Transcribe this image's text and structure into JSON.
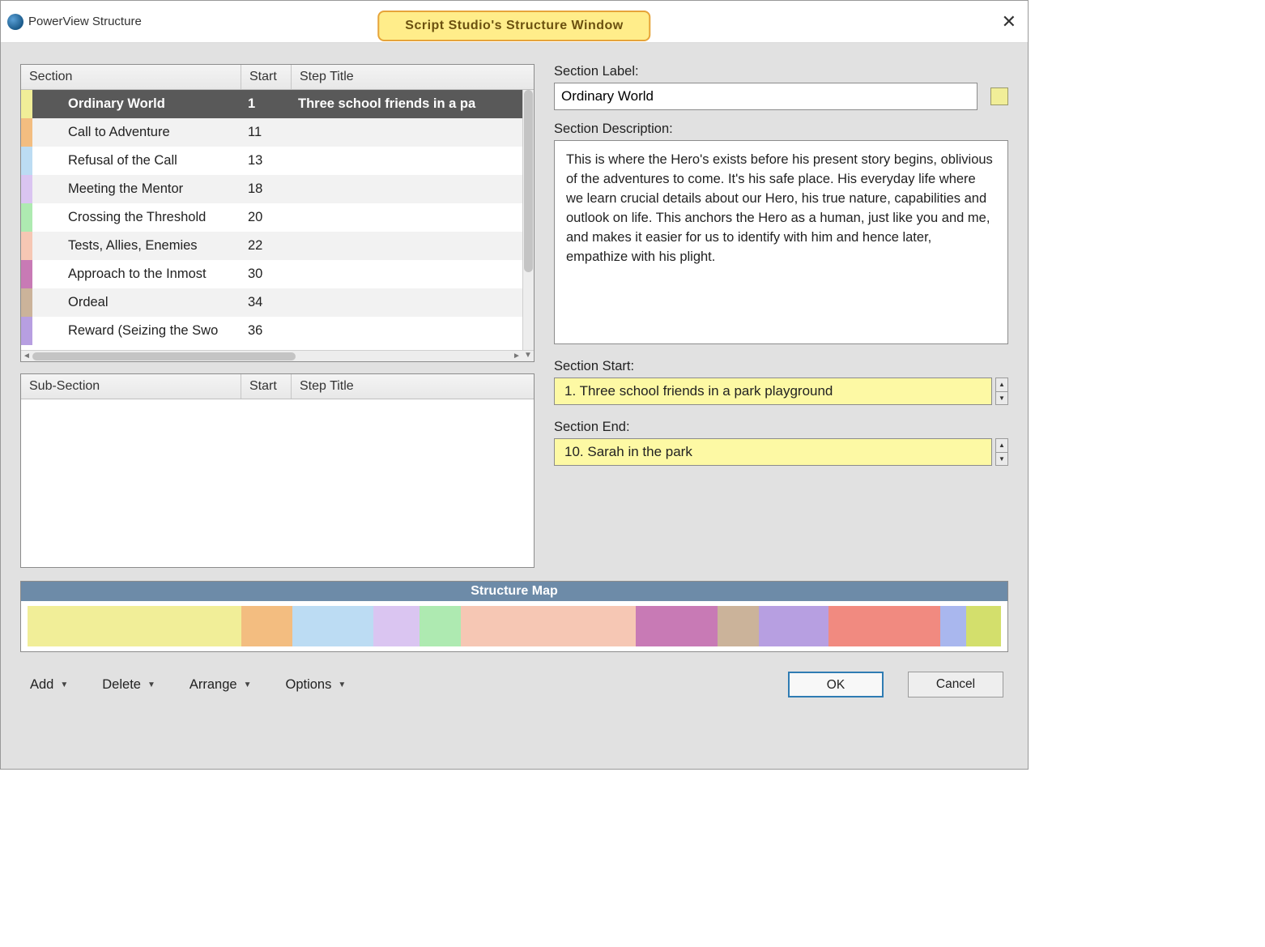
{
  "window": {
    "title": "PowerView Structure",
    "banner": "Script Studio's Structure Window"
  },
  "section_table": {
    "headers": {
      "section": "Section",
      "start": "Start",
      "step": "Step Title"
    },
    "rows": [
      {
        "color": "#f1ee98",
        "name": "Ordinary World",
        "start": "1",
        "step": "Three school friends in a pa",
        "selected": true
      },
      {
        "color": "#f3bd80",
        "name": "Call to Adventure",
        "start": "11",
        "step": ""
      },
      {
        "color": "#bcdcf3",
        "name": "Refusal of the Call",
        "start": "13",
        "step": ""
      },
      {
        "color": "#dac5f1",
        "name": "Meeting the Mentor",
        "start": "18",
        "step": ""
      },
      {
        "color": "#aeeab1",
        "name": "Crossing the Threshold",
        "start": "20",
        "step": ""
      },
      {
        "color": "#f6c7b4",
        "name": "Tests, Allies, Enemies",
        "start": "22",
        "step": ""
      },
      {
        "color": "#c87ab5",
        "name": "Approach to the Inmost",
        "start": "30",
        "step": ""
      },
      {
        "color": "#cbb39a",
        "name": "Ordeal",
        "start": "34",
        "step": ""
      },
      {
        "color": "#b79fe1",
        "name": "Reward (Seizing the Swo",
        "start": "36",
        "step": ""
      }
    ]
  },
  "subsection_table": {
    "headers": {
      "section": "Sub-Section",
      "start": "Start",
      "step": "Step Title"
    }
  },
  "details": {
    "label_caption": "Section Label:",
    "label_value": "Ordinary World",
    "color": "#f1ee98",
    "desc_caption": "Section Description:",
    "desc_value": "This is where the Hero's exists before his present story begins, oblivious of the adventures to come.  It's his safe place.  His everyday life where we learn crucial details about our Hero, his true nature, capabilities and outlook on life.  This anchors the Hero as a human, just like you and me, and makes it easier for us to identify with him and hence later, empathize with his plight.",
    "start_caption": "Section Start:",
    "start_value": "1. Three school friends in a park playground",
    "end_caption": "Section End:",
    "end_value": "10. Sarah in the park"
  },
  "structure_map": {
    "title": "Structure Map",
    "segments": [
      {
        "color": "#f1ee98",
        "width": 22
      },
      {
        "color": "#f3bd80",
        "width": 5.2
      },
      {
        "color": "#bcdcf3",
        "width": 8.3
      },
      {
        "color": "#dac5f1",
        "width": 4.8
      },
      {
        "color": "#aeeab1",
        "width": 4.2
      },
      {
        "color": "#f6c7b4",
        "width": 18
      },
      {
        "color": "#c87ab5",
        "width": 8.4
      },
      {
        "color": "#cbb39a",
        "width": 4.2
      },
      {
        "color": "#b79fe1",
        "width": 7.2
      },
      {
        "color": "#f18a80",
        "width": 11.5
      },
      {
        "color": "#a9b7ee",
        "width": 2.6
      },
      {
        "color": "#d3df6c",
        "width": 3.6
      }
    ]
  },
  "menus": {
    "add": "Add",
    "delete": "Delete",
    "arrange": "Arrange",
    "options": "Options"
  },
  "buttons": {
    "ok": "OK",
    "cancel": "Cancel"
  }
}
